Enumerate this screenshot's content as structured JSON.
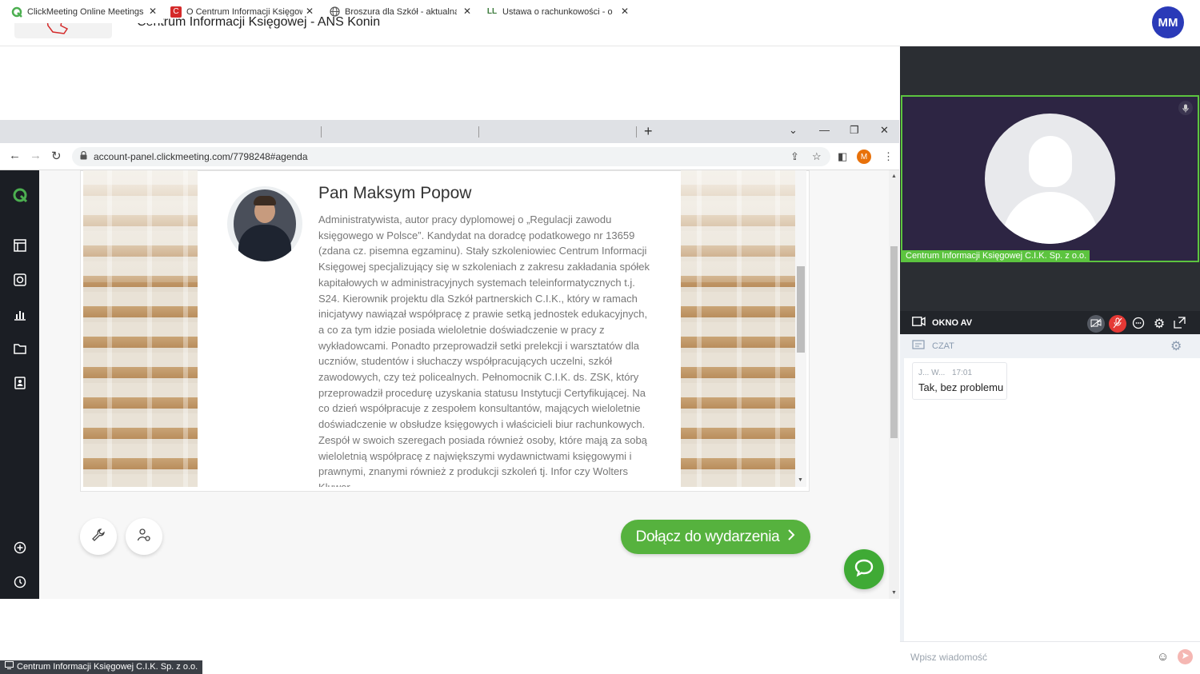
{
  "app": {
    "title": "Centrum Informacji Księgowej - ANS Konin",
    "user_initials": "MM"
  },
  "browser": {
    "tabs": [
      {
        "label": "ClickMeeting Online Meetings",
        "icon": "clickmeeting-icon",
        "active": true
      },
      {
        "label": "O Centrum Informacji Księgowej",
        "icon": "cik-icon",
        "active": false
      },
      {
        "label": "Broszura dla Szkół - aktualna.pdf",
        "icon": "globe-icon",
        "active": false
      },
      {
        "label": "Ustawa o rachunkowości - o rach",
        "icon": "lex-icon",
        "active": false
      }
    ],
    "url": "account-panel.clickmeeting.com/7798248#agenda",
    "profile_initial": "M"
  },
  "page": {
    "speaker_name": "Pan Maksym Popow",
    "speaker_bio": "Administratywista, autor pracy dyplomowej o „Regulacji zawodu księgowego w Polsce”. Kandydat na doradcę podatkowego nr 13659 (zdana cz. pisemna egzaminu). Stały szkoleniowiec Centrum Informacji Księgowej specjalizujący się w szkoleniach z zakresu zakładania spółek kapitałowych w administracyjnych systemach teleinformatycznych t.j. S24. Kierownik projektu dla Szkół partnerskich C.I.K., który w ramach inicjatywy nawiązał współpracę z prawie setką jednostek edukacyjnych, a co za tym idzie posiada wieloletnie doświadczenie w pracy z wykładowcami. Ponadto przeprowadził setki prelekcji i warsztatów dla uczniów, studentów i słuchaczy współpracujących uczelni, szkół zawodowych, czy też policealnych. Pełnomocnik C.I.K. ds. ZSK, który przeprowadził procedurę uzyskania statusu Instytucji Certyfikującej. Na co dzień współpracuje z zespołem konsultantów, mających wieloletnie doświadczenie w obsłudze księgowych i właścicieli biur rachunkowych. Zespół w swoich szeregach posiada również osoby, które mają za sobą wieloletnią współpracę z największymi wydawnictwami księgowymi i prawnymi, znanymi również z produkcji szkoleń tj. Infor czy Wolters Kluwer.",
    "join_button": "Dołącz do wydarzenia"
  },
  "presenter_tag": "Centrum Informacji Księgowej C.I.K. Sp. z o.o.",
  "video": {
    "participant_name": "Centrum Informacji Księgowej C.I.K. Sp. z o.o.",
    "av_label": "OKNO AV"
  },
  "chat": {
    "title": "CZAT",
    "messages": [
      {
        "author": "J... W...",
        "time": "17:01",
        "text": "Tak, bez problemu"
      }
    ],
    "input_placeholder": "Wpisz wiadomość"
  },
  "colors": {
    "accent_green": "#56b23e",
    "video_border": "#5cc43f",
    "user_avatar": "#2a3ab8",
    "mic_muted": "#e53935"
  }
}
